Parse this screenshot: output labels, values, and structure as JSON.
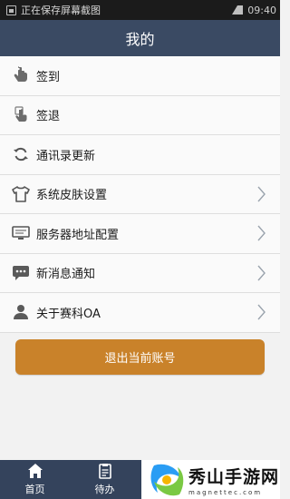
{
  "status_bar": {
    "notification_text": "正在保存屏幕截图",
    "time": "09:40"
  },
  "header": {
    "title": "我的"
  },
  "menu": [
    {
      "label": "签到",
      "icon": "finger-tap-icon",
      "chevron": false
    },
    {
      "label": "签退",
      "icon": "finger-press-icon",
      "chevron": false
    },
    {
      "label": "通讯录更新",
      "icon": "refresh-icon",
      "chevron": false
    },
    {
      "label": "系统皮肤设置",
      "icon": "shirt-icon",
      "chevron": true
    },
    {
      "label": "服务器地址配置",
      "icon": "monitor-icon",
      "chevron": true
    },
    {
      "label": "新消息通知",
      "icon": "chat-bubble-icon",
      "chevron": true
    },
    {
      "label": "关于赛科OA",
      "icon": "person-icon",
      "chevron": true
    }
  ],
  "logout_button": {
    "label": "退出当前账号"
  },
  "tabs": [
    {
      "label": "首页",
      "icon": "home-icon"
    },
    {
      "label": "待办",
      "icon": "clipboard-icon"
    }
  ],
  "watermark": {
    "title": "秀山手游网",
    "subtitle": "magnettec.com"
  },
  "colors": {
    "header": "#3a4a63",
    "tabbar": "#34435c",
    "logout": "#c9822a"
  }
}
